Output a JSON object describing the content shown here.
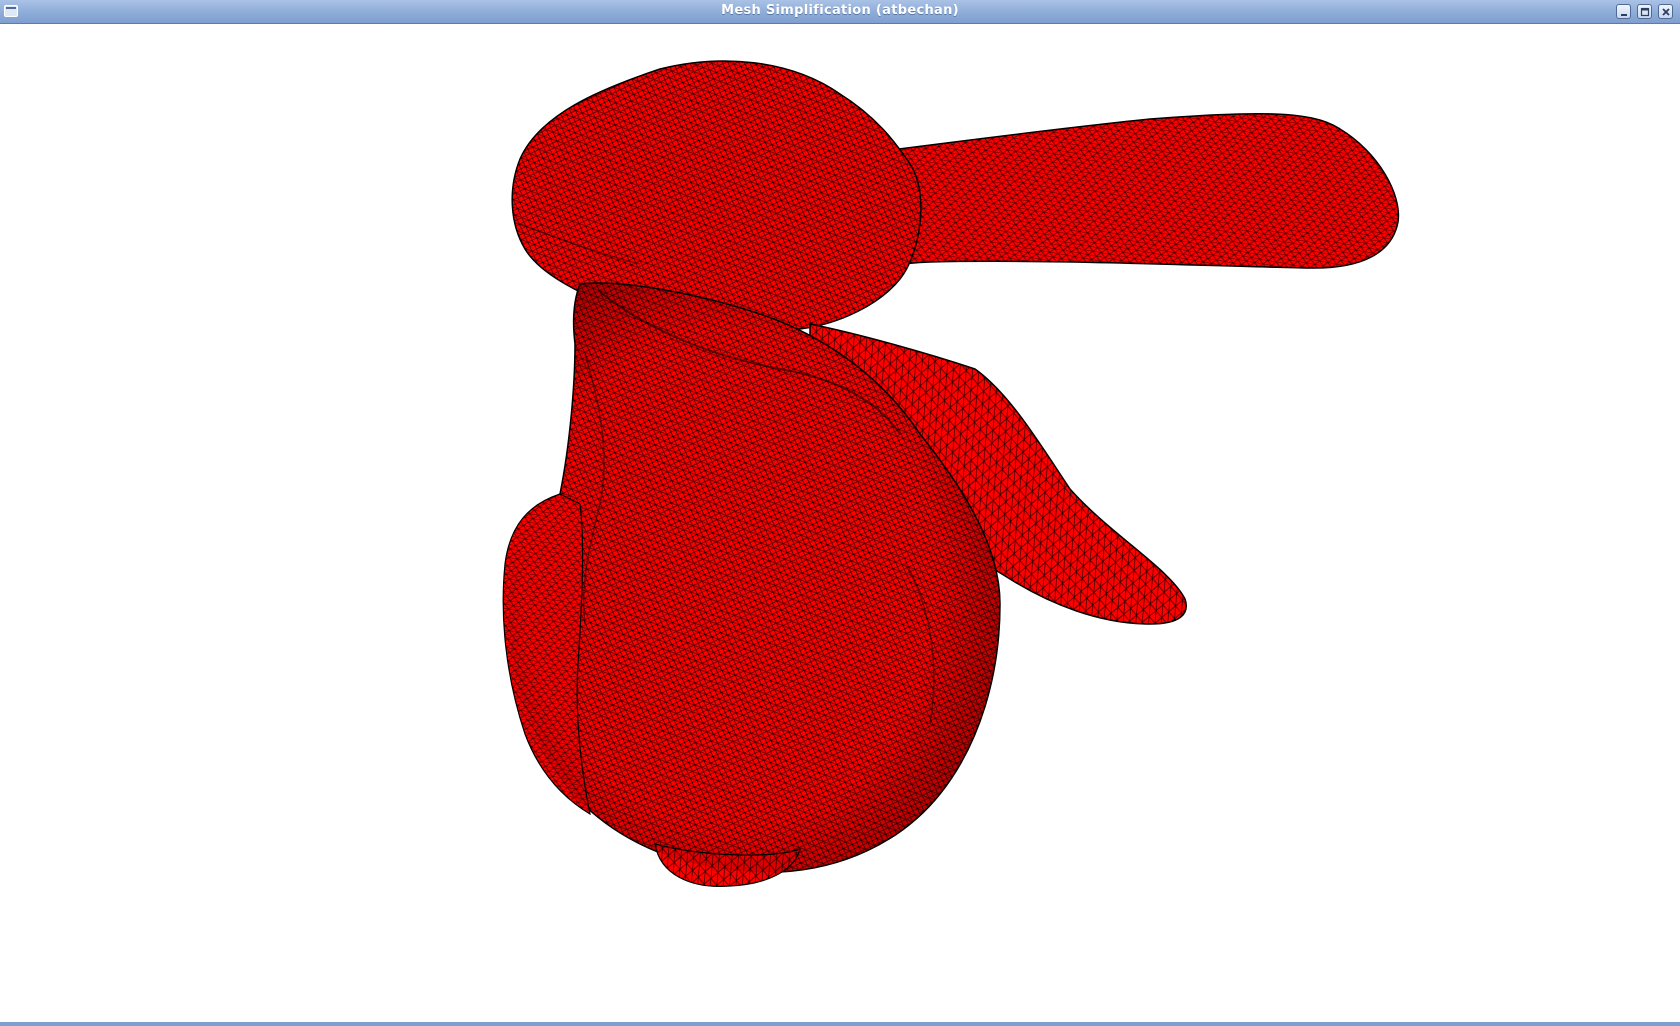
{
  "window": {
    "title": "Mesh Simplification (atbechan)",
    "icons": {
      "menu": "window-menu-icon",
      "minimize": "minimize-icon",
      "maximize": "maximize-icon",
      "close": "close-icon"
    }
  },
  "viewport": {
    "model": "bunny-mesh-wireframe",
    "fill_color": "#ff0000",
    "wire_color": "#000000",
    "background": "#ffffff"
  },
  "colors": {
    "titlebar": "#8eacd8",
    "title_text": "#ffffff"
  }
}
